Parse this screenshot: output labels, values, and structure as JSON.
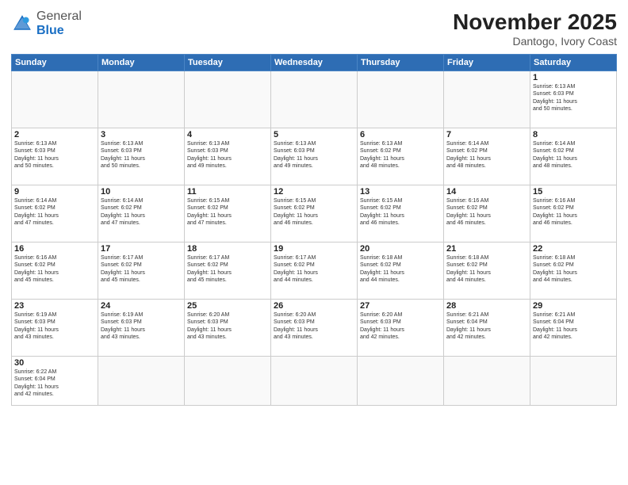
{
  "header": {
    "logo_general": "General",
    "logo_blue": "Blue",
    "month_title": "November 2025",
    "location": "Dantogo, Ivory Coast"
  },
  "weekdays": [
    "Sunday",
    "Monday",
    "Tuesday",
    "Wednesday",
    "Thursday",
    "Friday",
    "Saturday"
  ],
  "weeks": [
    [
      {
        "day": "",
        "info": ""
      },
      {
        "day": "",
        "info": ""
      },
      {
        "day": "",
        "info": ""
      },
      {
        "day": "",
        "info": ""
      },
      {
        "day": "",
        "info": ""
      },
      {
        "day": "",
        "info": ""
      },
      {
        "day": "1",
        "info": "Sunrise: 6:13 AM\nSunset: 6:03 PM\nDaylight: 11 hours\nand 50 minutes."
      }
    ],
    [
      {
        "day": "2",
        "info": "Sunrise: 6:13 AM\nSunset: 6:03 PM\nDaylight: 11 hours\nand 50 minutes."
      },
      {
        "day": "3",
        "info": "Sunrise: 6:13 AM\nSunset: 6:03 PM\nDaylight: 11 hours\nand 50 minutes."
      },
      {
        "day": "4",
        "info": "Sunrise: 6:13 AM\nSunset: 6:03 PM\nDaylight: 11 hours\nand 49 minutes."
      },
      {
        "day": "5",
        "info": "Sunrise: 6:13 AM\nSunset: 6:03 PM\nDaylight: 11 hours\nand 49 minutes."
      },
      {
        "day": "6",
        "info": "Sunrise: 6:13 AM\nSunset: 6:02 PM\nDaylight: 11 hours\nand 48 minutes."
      },
      {
        "day": "7",
        "info": "Sunrise: 6:14 AM\nSunset: 6:02 PM\nDaylight: 11 hours\nand 48 minutes."
      },
      {
        "day": "8",
        "info": "Sunrise: 6:14 AM\nSunset: 6:02 PM\nDaylight: 11 hours\nand 48 minutes."
      }
    ],
    [
      {
        "day": "9",
        "info": "Sunrise: 6:14 AM\nSunset: 6:02 PM\nDaylight: 11 hours\nand 47 minutes."
      },
      {
        "day": "10",
        "info": "Sunrise: 6:14 AM\nSunset: 6:02 PM\nDaylight: 11 hours\nand 47 minutes."
      },
      {
        "day": "11",
        "info": "Sunrise: 6:15 AM\nSunset: 6:02 PM\nDaylight: 11 hours\nand 47 minutes."
      },
      {
        "day": "12",
        "info": "Sunrise: 6:15 AM\nSunset: 6:02 PM\nDaylight: 11 hours\nand 46 minutes."
      },
      {
        "day": "13",
        "info": "Sunrise: 6:15 AM\nSunset: 6:02 PM\nDaylight: 11 hours\nand 46 minutes."
      },
      {
        "day": "14",
        "info": "Sunrise: 6:16 AM\nSunset: 6:02 PM\nDaylight: 11 hours\nand 46 minutes."
      },
      {
        "day": "15",
        "info": "Sunrise: 6:16 AM\nSunset: 6:02 PM\nDaylight: 11 hours\nand 46 minutes."
      }
    ],
    [
      {
        "day": "16",
        "info": "Sunrise: 6:16 AM\nSunset: 6:02 PM\nDaylight: 11 hours\nand 45 minutes."
      },
      {
        "day": "17",
        "info": "Sunrise: 6:17 AM\nSunset: 6:02 PM\nDaylight: 11 hours\nand 45 minutes."
      },
      {
        "day": "18",
        "info": "Sunrise: 6:17 AM\nSunset: 6:02 PM\nDaylight: 11 hours\nand 45 minutes."
      },
      {
        "day": "19",
        "info": "Sunrise: 6:17 AM\nSunset: 6:02 PM\nDaylight: 11 hours\nand 44 minutes."
      },
      {
        "day": "20",
        "info": "Sunrise: 6:18 AM\nSunset: 6:02 PM\nDaylight: 11 hours\nand 44 minutes."
      },
      {
        "day": "21",
        "info": "Sunrise: 6:18 AM\nSunset: 6:02 PM\nDaylight: 11 hours\nand 44 minutes."
      },
      {
        "day": "22",
        "info": "Sunrise: 6:18 AM\nSunset: 6:02 PM\nDaylight: 11 hours\nand 44 minutes."
      }
    ],
    [
      {
        "day": "23",
        "info": "Sunrise: 6:19 AM\nSunset: 6:03 PM\nDaylight: 11 hours\nand 43 minutes."
      },
      {
        "day": "24",
        "info": "Sunrise: 6:19 AM\nSunset: 6:03 PM\nDaylight: 11 hours\nand 43 minutes."
      },
      {
        "day": "25",
        "info": "Sunrise: 6:20 AM\nSunset: 6:03 PM\nDaylight: 11 hours\nand 43 minutes."
      },
      {
        "day": "26",
        "info": "Sunrise: 6:20 AM\nSunset: 6:03 PM\nDaylight: 11 hours\nand 43 minutes."
      },
      {
        "day": "27",
        "info": "Sunrise: 6:20 AM\nSunset: 6:03 PM\nDaylight: 11 hours\nand 42 minutes."
      },
      {
        "day": "28",
        "info": "Sunrise: 6:21 AM\nSunset: 6:04 PM\nDaylight: 11 hours\nand 42 minutes."
      },
      {
        "day": "29",
        "info": "Sunrise: 6:21 AM\nSunset: 6:04 PM\nDaylight: 11 hours\nand 42 minutes."
      }
    ],
    [
      {
        "day": "30",
        "info": "Sunrise: 6:22 AM\nSunset: 6:04 PM\nDaylight: 11 hours\nand 42 minutes."
      },
      {
        "day": "",
        "info": ""
      },
      {
        "day": "",
        "info": ""
      },
      {
        "day": "",
        "info": ""
      },
      {
        "day": "",
        "info": ""
      },
      {
        "day": "",
        "info": ""
      },
      {
        "day": "",
        "info": ""
      }
    ]
  ]
}
